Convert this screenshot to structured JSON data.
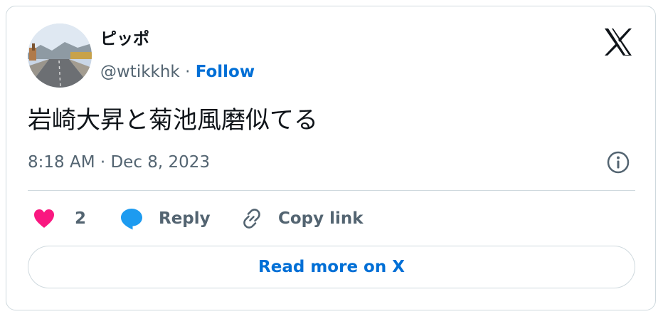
{
  "author": {
    "display_name": "ピッポ",
    "handle": "@wtikkhk",
    "separator": " · ",
    "follow_label": "Follow"
  },
  "tweet": {
    "text": "岩崎大昇と菊池風磨似てる",
    "timestamp": "8:18 AM · Dec 8, 2023"
  },
  "actions": {
    "like_count": "2",
    "reply_label": "Reply",
    "copy_link_label": "Copy link"
  },
  "footer": {
    "read_more_label": "Read more on X"
  },
  "colors": {
    "like": "#f91880",
    "reply": "#1d9bf0",
    "link": "#006fd6",
    "muted": "#536471",
    "text": "#0f1419",
    "border": "#cfd9de"
  },
  "icons": {
    "brand": "x-logo-icon",
    "info": "info-icon",
    "like": "heart-icon",
    "reply": "speech-bubble-icon",
    "copy": "link-icon"
  }
}
